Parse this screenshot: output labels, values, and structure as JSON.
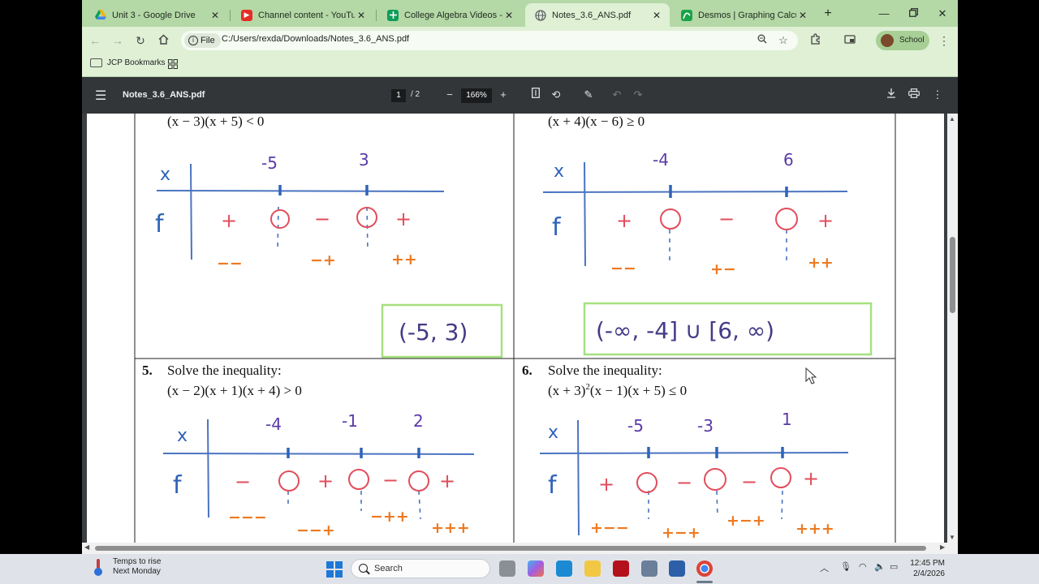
{
  "tabs": [
    {
      "title": "Unit 3 - Google Drive",
      "color": "#f4b400",
      "active": false
    },
    {
      "title": "Channel content - YouTube Stu",
      "color": "#e52d27",
      "active": false
    },
    {
      "title": "College Algebra Videos - Goo",
      "color": "#0f9d58",
      "active": false
    },
    {
      "title": "Notes_3.6_ANS.pdf",
      "color": "#5f6368",
      "active": true
    },
    {
      "title": "Desmos | Graphing Calculator",
      "color": "#1aa34a",
      "active": false
    }
  ],
  "address": {
    "chip": "File",
    "url": "C:/Users/rexda/Downloads/Notes_3.6_ANS.pdf"
  },
  "profile": {
    "label": "School"
  },
  "bookmarks": {
    "folder": "JCP Bookmarks"
  },
  "pdf": {
    "title": "Notes_3.6_ANS.pdf",
    "page_current": "1",
    "page_total": "/  2",
    "zoom": "166%"
  },
  "problems": {
    "p3_expr": "(x − 3)(x + 5) < 0",
    "p4_expr": "(x + 4)(x − 6) ≥ 0",
    "p5_num": "5.",
    "p5_title": "Solve the inequality:",
    "p5_expr": "(x − 2)(x + 1)(x + 4) > 0",
    "p6_num": "6.",
    "p6_title": "Solve the inequality:",
    "p6_expr_a": "(x + 3)",
    "p6_expr_sup": "2",
    "p6_expr_b": "(x − 1)(x + 5) ≤ 0"
  },
  "handwriting": {
    "x": "x",
    "f": "f",
    "q3": {
      "crit1": "-5",
      "crit2": "3",
      "s1": "+",
      "s2": "−",
      "s3": "+",
      "f1": "−−",
      "f2": "−+",
      "f3": "++",
      "answer": "(-5, 3)"
    },
    "q4": {
      "crit1": "-4",
      "crit2": "6",
      "s1": "+",
      "s2": "−",
      "s3": "+",
      "f1": "−−",
      "f2": "+−",
      "f3": "++",
      "answer": "(-∞, -4] ∪ [6, ∞)"
    },
    "q5": {
      "crit1": "-4",
      "crit2": "-1",
      "crit3": "2",
      "s1": "−",
      "s2": "+",
      "s3": "−",
      "s4": "+",
      "f1": "−−−",
      "f2": "−−+",
      "f3": "−++",
      "f4": "+++"
    },
    "q6": {
      "crit1": "-5",
      "crit2": "-3",
      "crit3": "1",
      "s1": "+",
      "s2": "−",
      "s3": "−",
      "s4": "+",
      "f1": "+−−",
      "f2": "+−+",
      "f3": "+−+",
      "f4": "+++"
    }
  },
  "taskbar": {
    "weather_line1": "Temps to rise",
    "weather_line2": "Next Monday",
    "search": "Search",
    "time": "12:45 PM",
    "date": "2/4/2026"
  }
}
